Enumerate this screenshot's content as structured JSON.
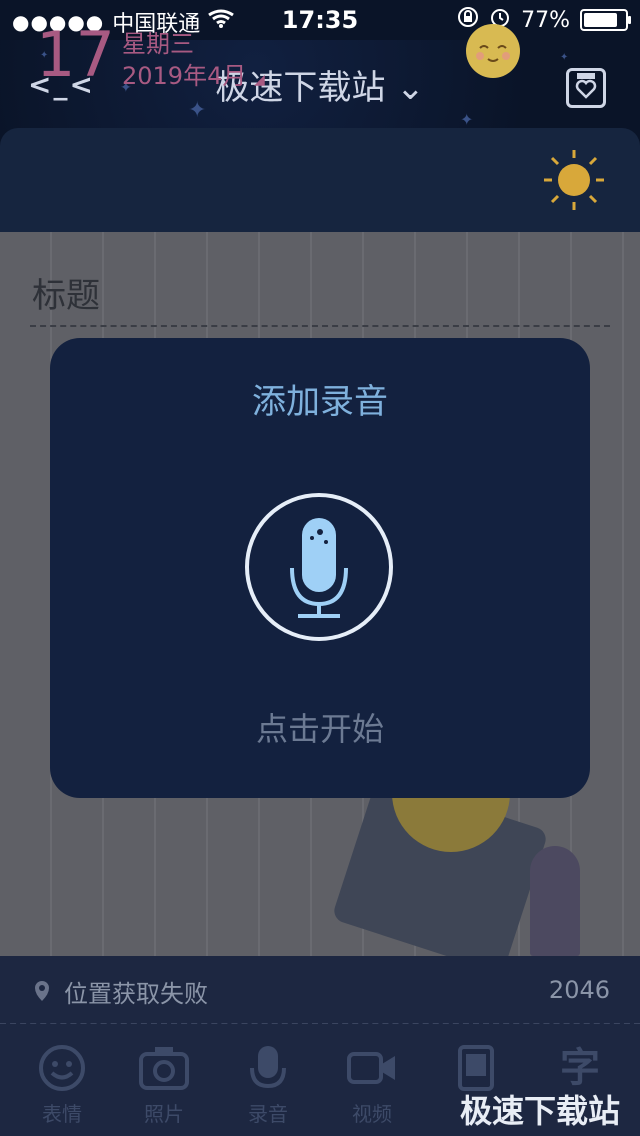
{
  "status": {
    "carrier": "中国联通",
    "time": "17:35",
    "battery": "77%"
  },
  "nav": {
    "back": "<_<",
    "title": "极速下载站 ⌄"
  },
  "date": {
    "day": "17",
    "weekday": "星期三",
    "month_year": "2019年4月"
  },
  "editor": {
    "title_placeholder": "标题"
  },
  "modal": {
    "title": "添加录音",
    "hint": "点击开始"
  },
  "footer": {
    "location": "位置获取失败",
    "count": "2046"
  },
  "toolbar": {
    "emoji": "表情",
    "photo": "照片",
    "audio": "录音",
    "video": "视频",
    "letter": "信",
    "word": "字"
  },
  "watermark": "极速下载站"
}
